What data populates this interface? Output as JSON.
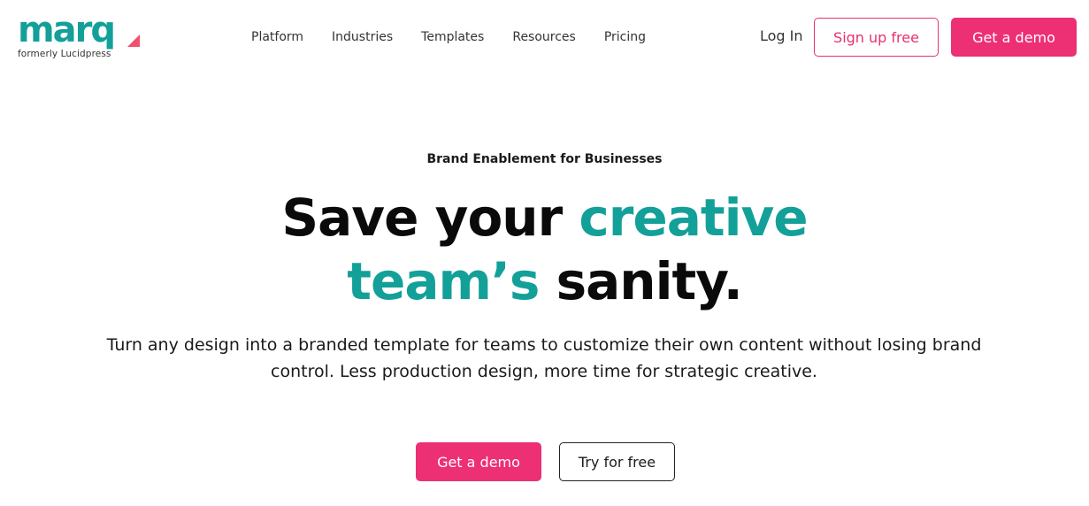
{
  "brand": {
    "logo_text": "marq",
    "subtitle": "formerly Lucidpress",
    "teal": "#13a099",
    "pink": "#ed2f74",
    "mark_color": "#f0506e"
  },
  "nav": {
    "items": [
      {
        "label": "Platform"
      },
      {
        "label": "Industries"
      },
      {
        "label": "Templates"
      },
      {
        "label": "Resources"
      },
      {
        "label": "Pricing"
      }
    ]
  },
  "header_actions": {
    "login": "Log In",
    "signup": "Sign up free",
    "demo": "Get a demo"
  },
  "hero": {
    "eyebrow": "Brand Enablement for Businesses",
    "headline_part1": "Save your ",
    "headline_accent1": "creative",
    "headline_accent2": "team’s",
    "headline_part2": " sanity.",
    "subtext": "Turn any design into a branded template for teams to customize their own content without losing brand control. Less production design, more time for strategic creative.",
    "cta_primary": "Get a demo",
    "cta_secondary": "Try for free"
  }
}
